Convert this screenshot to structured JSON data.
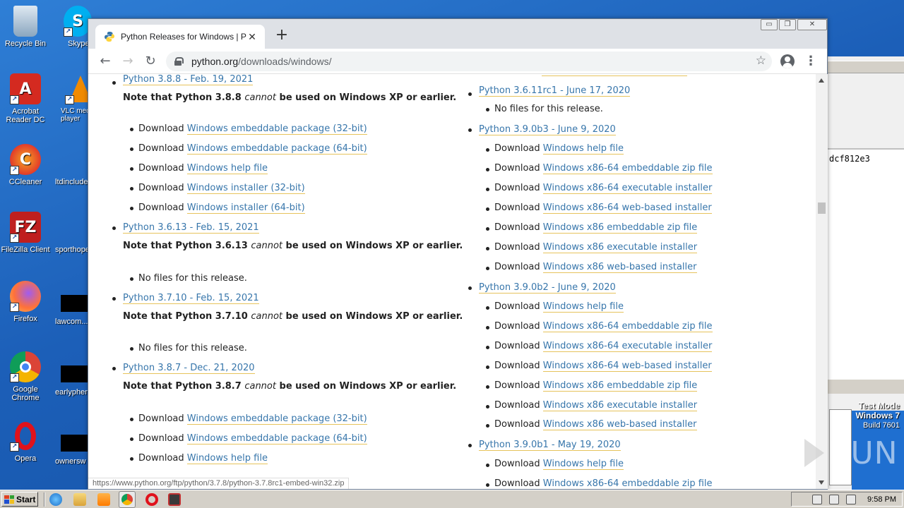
{
  "desktop": {
    "icons": [
      {
        "label": "Recycle Bin",
        "name": "recycle-bin-icon"
      },
      {
        "label": "Acrobat Reader DC",
        "name": "acrobat-reader-icon"
      },
      {
        "label": "CCleaner",
        "name": "ccleaner-icon"
      },
      {
        "label": "FileZilla Client",
        "name": "filezilla-icon"
      },
      {
        "label": "Firefox",
        "name": "firefox-icon"
      },
      {
        "label": "Google Chrome",
        "name": "google-chrome-icon"
      },
      {
        "label": "Opera",
        "name": "opera-icon"
      }
    ],
    "icons2": [
      {
        "label": "Skype",
        "name": "skype-icon"
      },
      {
        "label": "VLC media player",
        "name": "vlc-icon"
      },
      {
        "label": "ltdinclude",
        "name": "file-icon"
      },
      {
        "label": "sporthope",
        "name": "file-icon"
      },
      {
        "label": "lawcom...",
        "name": "file-icon"
      },
      {
        "label": "earlyphen",
        "name": "file-icon"
      },
      {
        "label": "ownersw",
        "name": "file-icon"
      }
    ],
    "bg_window_text": "dcf812e3",
    "test_mode": {
      "line1": "Test Mode",
      "line2": "Windows 7",
      "line3": "Build 7601"
    },
    "watermark": "ANY RUN"
  },
  "browser": {
    "tab_title": "Python Releases for Windows | Python.org",
    "new_tab": "+",
    "url_host": "python.org",
    "url_path": "/downloads/windows/",
    "status_url": "https://www.python.org/ftp/python/3.7.8/python-3.7.8rc1-embed-win32.zip",
    "win_controls": {
      "minimize": "▭",
      "restore": "❐",
      "close": "✕"
    }
  },
  "left_column": {
    "r1": {
      "link": "Python 3.8.8 - Feb. 19, 2021",
      "note_pre": "Note that Python 3.8.8 ",
      "note_em": "cannot",
      "note_post": " be used on Windows XP or earlier."
    },
    "r1_downloads": [
      "Windows embeddable package (32-bit)",
      "Windows embeddable package (64-bit)",
      "Windows help file",
      "Windows installer (32-bit)",
      "Windows installer (64-bit)"
    ],
    "r2": {
      "link": "Python 3.6.13 - Feb. 15, 2021",
      "note_pre": "Note that Python 3.6.13 ",
      "note_em": "cannot",
      "note_post": " be used on Windows XP or earlier.",
      "nofiles": "No files for this release."
    },
    "r3": {
      "link": "Python 3.7.10 - Feb. 15, 2021",
      "note_pre": "Note that Python 3.7.10 ",
      "note_em": "cannot",
      "note_post": " be used on Windows XP or earlier.",
      "nofiles": "No files for this release."
    },
    "r4": {
      "link": "Python 3.8.7 - Dec. 21, 2020",
      "note_pre": "Note that Python 3.8.7 ",
      "note_em": "cannot",
      "note_post": " be used on Windows XP or earlier."
    },
    "r4_downloads": [
      "Windows embeddable package (32-bit)",
      "Windows embeddable package (64-bit)",
      "Windows help file"
    ],
    "download_word": "Download "
  },
  "right_column": {
    "r1": {
      "link": "Python 3.6.11rc1 - June 17, 2020",
      "nofiles": "No files for this release."
    },
    "r2": {
      "link": "Python 3.9.0b3 - June 9, 2020"
    },
    "r2_downloads": [
      "Windows help file",
      "Windows x86-64 embeddable zip file",
      "Windows x86-64 executable installer",
      "Windows x86-64 web-based installer",
      "Windows x86 embeddable zip file",
      "Windows x86 executable installer",
      "Windows x86 web-based installer"
    ],
    "r3": {
      "link": "Python 3.9.0b2 - June 9, 2020"
    },
    "r3_downloads": [
      "Windows help file",
      "Windows x86-64 embeddable zip file",
      "Windows x86-64 executable installer",
      "Windows x86-64 web-based installer",
      "Windows x86 embeddable zip file",
      "Windows x86 executable installer",
      "Windows x86 web-based installer"
    ],
    "r4": {
      "link": "Python 3.9.0b1 - May 19, 2020"
    },
    "r4_downloads": [
      "Windows help file",
      "Windows x86-64 embeddable zip file"
    ]
  },
  "taskbar": {
    "start_label": "Start",
    "clock": "9:58 PM",
    "apps": [
      "ie-icon",
      "explorer-icon",
      "media-player-icon",
      "chrome-taskbar-icon",
      "opera-taskbar-icon",
      "app-taskbar-icon"
    ]
  }
}
